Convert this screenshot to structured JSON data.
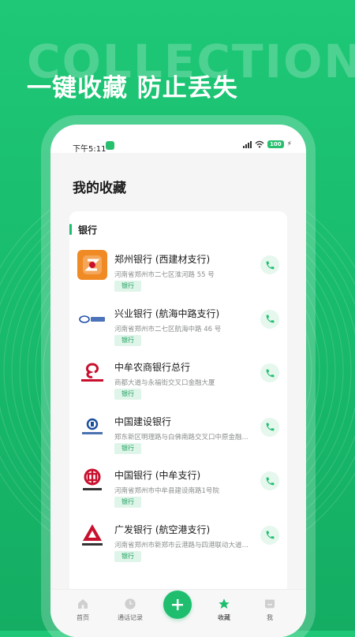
{
  "hero": {
    "bg_text": "COLLECTION",
    "title": "一键收藏 防止丢失"
  },
  "status_bar": {
    "time": "下午5:11",
    "battery": "100"
  },
  "page": {
    "title": "我的收藏"
  },
  "section": {
    "label": "银行"
  },
  "banks": [
    {
      "name": "郑州银行 (西建材支行)",
      "address": "河南省郑州市二七区淮河路 55 号",
      "tag": "银行",
      "icon": "zhengzhou-bank-logo"
    },
    {
      "name": "兴业银行 (航海中路支行)",
      "address": "河南省郑州市二七区航海中路 46 号",
      "tag": "银行",
      "icon": "industrial-bank-logo"
    },
    {
      "name": "中牟农商银行总行",
      "address": "商都大道与永福街交叉口金融大厦",
      "tag": "银行",
      "icon": "zhongmou-rural-bank-logo"
    },
    {
      "name": "中国建设银行",
      "address": "郑东新区明理路与白佛南路交叉口中原金融...",
      "tag": "银行",
      "icon": "ccb-logo"
    },
    {
      "name": "中国银行 (中牟支行)",
      "address": "河南省郑州市中牟县建设南路1号院",
      "tag": "银行",
      "icon": "boc-logo"
    },
    {
      "name": "广发银行 (航空港支行)",
      "address": "河南省郑州市新郑市云港路与四港联动大道交叉口...",
      "tag": "银行",
      "icon": "cgb-logo"
    }
  ],
  "tabbar": {
    "home": "首页",
    "calls": "通话记录",
    "favorites": "收藏",
    "me": "我"
  },
  "colors": {
    "brand_green": "#1fbe6f",
    "tag_bg": "#dff5e9",
    "bank_orange": "#f08a24",
    "bank_red": "#c8102e"
  }
}
